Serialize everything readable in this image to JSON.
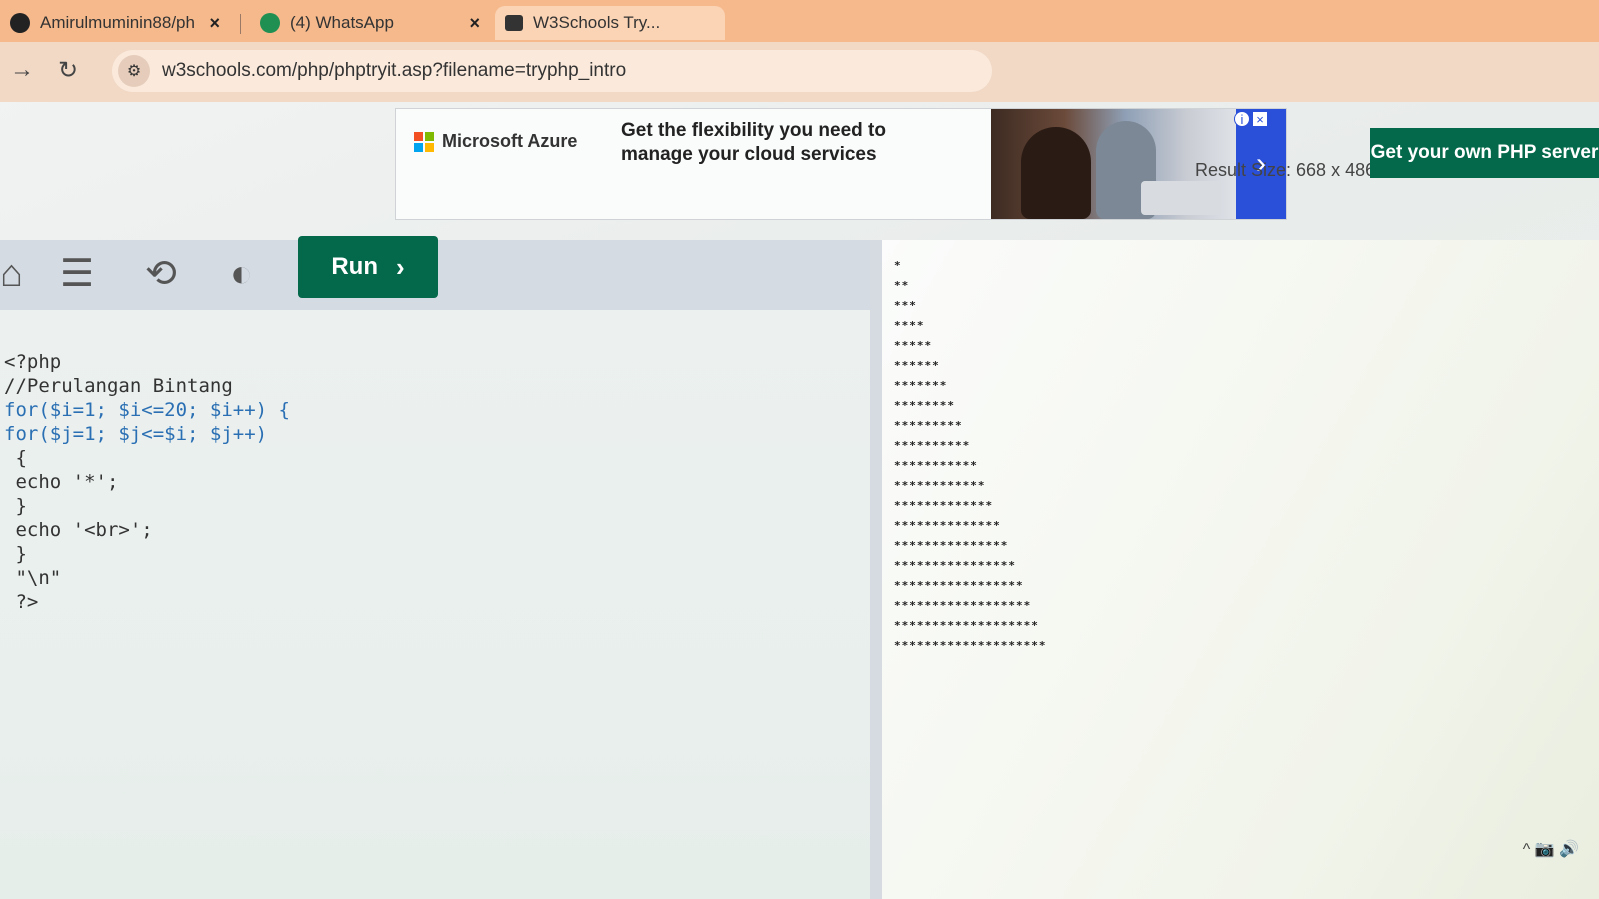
{
  "browser": {
    "tabs": [
      {
        "title": "Amirulmuminin88/ph",
        "close": "×"
      },
      {
        "title": "(4) WhatsApp",
        "close": "×"
      },
      {
        "title": "W3Schools Try..."
      }
    ],
    "nav": {
      "forward": "→",
      "reload": "↻"
    },
    "url": "w3schools.com/php/phptryit.asp?filename=tryphp_intro"
  },
  "ad": {
    "brand": "Microsoft Azure",
    "headline": "Get the flexibility you need to manage your cloud services",
    "next": "›",
    "colors": [
      "#f25022",
      "#7fba00",
      "#00a4ef",
      "#ffb900"
    ]
  },
  "toolbar": {
    "result_size": "Result Size: 668 x 486",
    "php_server_label": "Get your own PHP server",
    "run_label": "Run",
    "run_chevron": "›"
  },
  "editor": {
    "lines": [
      "<?php",
      "//Perulangan Bintang",
      "for($i=1; $i<=20; $i++) {",
      "for($j=1; $j<=$i; $j++)",
      " {",
      " echo '*';",
      " }",
      " echo '<br>';",
      " }",
      " \"\\n\"",
      " ?>"
    ]
  },
  "result": {
    "rows": [
      "*",
      "**",
      "***",
      "****",
      "*****",
      "******",
      "*******",
      "********",
      "*********",
      "**********",
      "***********",
      "************",
      "*************",
      "**************",
      "***************",
      "****************",
      "*****************",
      "******************",
      "*******************",
      "********************"
    ]
  },
  "tray": {
    "icons": "^ 📷 🔊"
  },
  "accent": {
    "green": "#04694a",
    "tab_orange": "#f5b98c",
    "ad_blue": "#2a4fd8"
  }
}
